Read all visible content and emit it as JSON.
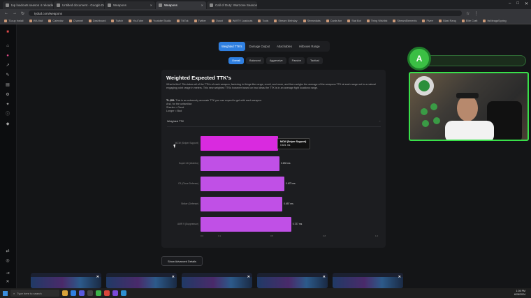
{
  "browser": {
    "tabs": [
      {
        "label": "top loadouts season 4 reloaded...",
        "active": false
      },
      {
        "label": "Untitled document - Google Do...",
        "active": false
      },
      {
        "label": "Weapons",
        "active": false
      },
      {
        "label": "Weapons",
        "active": true
      },
      {
        "label": "Call of Duty: Warzone Season 4...",
        "active": false
      }
    ],
    "url": "tydud.com/weapons",
    "bookmarks": [
      "T1cup Install",
      "WA Mail",
      "Calendar",
      "Channel",
      "Dashboard",
      "Twitch",
      "YouTube",
      "Youtube Studio",
      "TikTok",
      "Twitter",
      "Ocast",
      "WWTV Loadouts",
      "Tools",
      "Stream Birthday",
      "Streamlabs",
      "Cards fun",
      "Stat Bot",
      "Thing Wishlist",
      "StreamElements",
      "Fiverr",
      "Blast Rang",
      "Elite Craft",
      "ItsMeagaSpying"
    ]
  },
  "weapon_type_tabs": [
    {
      "label": "Weighted TTK's",
      "active": true
    },
    {
      "label": "Damage Output",
      "active": false
    },
    {
      "label": "Attachables",
      "active": false
    },
    {
      "label": "Hitboxes Range",
      "active": false
    }
  ],
  "mode_tabs": [
    {
      "label": "Overall",
      "active": true
    },
    {
      "label": "Balanced",
      "active": false
    },
    {
      "label": "Aggressive",
      "active": false
    },
    {
      "label": "Passive",
      "active": false
    },
    {
      "label": "Tactical",
      "active": false
    }
  ],
  "card": {
    "title": "Weighted Expected TTK's",
    "description": "What is this? This takes all of the TTKs of each weapon, factoring in things like range, recoil, and more, and then weighs the average of the weapons TTK at each range out to a natural engaging point range in meters. This new weighted TTKs however based on two ideas the TTK is in an average fight locations range.",
    "tldr_label": "TL;DR:",
    "tldr_text": "This is an extremely accurate TTK you can expect to get with each weapon.",
    "legend_lines": [
      "And, for the unfamiliar:",
      "Shorter = Good",
      "Longer = Bad"
    ],
    "section_label": "Weighted TTK",
    "section_icon": "chevron-up-icon"
  },
  "chart_data": {
    "type": "bar",
    "orientation": "horizontal",
    "categories": [
      "MCW (Sniper Support)",
      "Superi 46 (Akimbo)",
      "C9 (Close Defense)",
      "Striker (Defense)",
      "AMR 9 (Suppressor)"
    ],
    "values": [
      0.621,
      0.633,
      0.673,
      0.657,
      0.727
    ],
    "value_labels": [
      "0.621 ms",
      "0.633 ms",
      "0.673 ms",
      "0.657 ms",
      "0.727 ms"
    ],
    "xticks": [
      "0.0",
      "0.1",
      "0.5",
      "0.8",
      "1.0"
    ],
    "highlight_index": 0,
    "tooltip": {
      "title": "MCW (Sniper Support)",
      "value": "0.621 ms"
    },
    "colors": {
      "bar": "#c050e6",
      "highlight": "#d92adf"
    }
  },
  "advanced_button": "Show Advanced Details",
  "taskbar": {
    "search_placeholder": "Type here to search",
    "time": "1:05 PM",
    "date": "6/28/2024"
  },
  "overlay_letter": "A"
}
